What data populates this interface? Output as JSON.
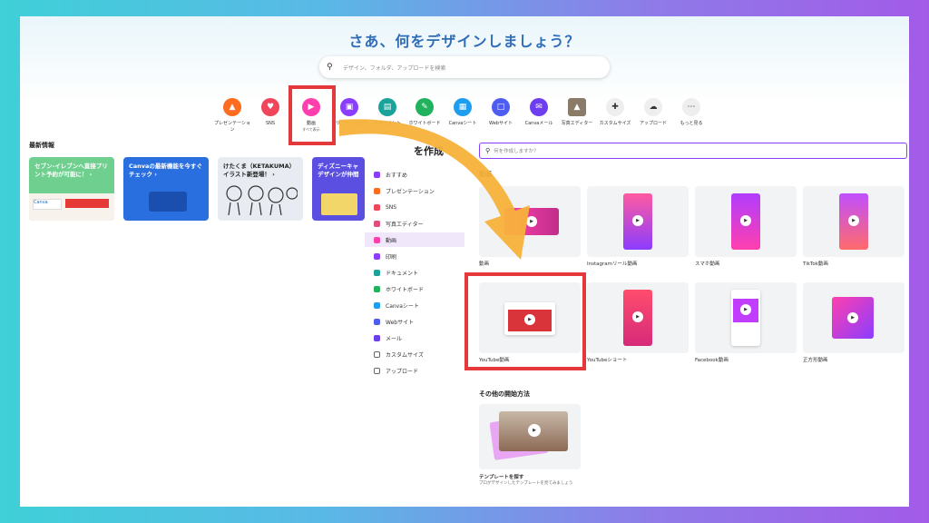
{
  "hero": {
    "title": "さあ、何をデザインしましょう？",
    "search_placeholder": "デザイン、フォルダ、アップロードを検索"
  },
  "categories": [
    {
      "label": "プレゼンテーション",
      "color": "#ff6b1f",
      "icon": "presentation-icon"
    },
    {
      "label": "SNS",
      "color": "#f0455a",
      "icon": "heart-icon"
    },
    {
      "label": "動画",
      "sub": "すべて表示",
      "color": "#ff3fae",
      "icon": "video-icon"
    },
    {
      "label": "プリントショップ",
      "color": "#8b3dff",
      "icon": "print-icon"
    },
    {
      "label": "ドキュメント",
      "color": "#1aa39a",
      "icon": "document-icon"
    },
    {
      "label": "ホワイトボード",
      "color": "#20b25c",
      "icon": "whiteboard-icon"
    },
    {
      "label": "Canvaシート",
      "color": "#1f9ef0",
      "icon": "sheet-icon"
    },
    {
      "label": "Webサイト",
      "color": "#4f5cf0",
      "icon": "website-icon"
    },
    {
      "label": "Canvaメール",
      "color": "#6d3df0",
      "icon": "mail-icon"
    },
    {
      "label": "写真エディター",
      "color": "#8a7b68",
      "icon": "photo-icon"
    },
    {
      "label": "カスタムサイズ",
      "color": "#eeeeee",
      "icon": "custom-size-icon"
    },
    {
      "label": "アップロード",
      "color": "#eeeeee",
      "icon": "upload-icon"
    },
    {
      "label": "もっと見る",
      "color": "#eeeeee",
      "icon": "more-icon"
    }
  ],
  "news": {
    "title": "最新情報",
    "cards": [
      {
        "text": "セブン-イレブンへ直接プリント予約が可能に！ ›",
        "bg": "#6fcf8f",
        "fg": "#ffffff"
      },
      {
        "text": "Canvaの最新機能を今すぐチェック ›",
        "bg": "#2a6fe0",
        "fg": "#ffffff"
      },
      {
        "text": "けたくま（KETAKUMA）イラスト新登場！ ›",
        "bg": "#e8ecf2",
        "fg": "#222222"
      },
      {
        "text": "ディズニーキャ デザインが仲間",
        "bg": "#5a4fe0",
        "fg": "#ffffff"
      }
    ]
  },
  "menu": {
    "title": "を作成",
    "items": [
      {
        "label": "おすすめ",
        "color": "#8b3dff"
      },
      {
        "label": "プレゼンテーション",
        "color": "#ff6b1f"
      },
      {
        "label": "SNS",
        "color": "#f0455a"
      },
      {
        "label": "写真エディター",
        "color": "#e04f7a"
      },
      {
        "label": "動画",
        "color": "#ff3fae",
        "active": true
      },
      {
        "label": "印刷",
        "color": "#8b3dff"
      },
      {
        "label": "ドキュメント",
        "color": "#1aa39a"
      },
      {
        "label": "ホワイトボード",
        "color": "#20b25c"
      },
      {
        "label": "Canvaシート",
        "color": "#1f9ef0"
      },
      {
        "label": "Webサイト",
        "color": "#4f5cf0"
      },
      {
        "label": "メール",
        "color": "#6d3df0"
      },
      {
        "label": "カスタムサイズ",
        "color": "#666666"
      },
      {
        "label": "アップロード",
        "color": "#666666"
      }
    ]
  },
  "panel": {
    "search_placeholder": "何を作成しますか？",
    "section_title": "動画",
    "tiles": [
      {
        "label": "動画"
      },
      {
        "label": "Instagramリール動画"
      },
      {
        "label": "スマホ動画"
      },
      {
        "label": "TikTok動画"
      },
      {
        "label": "YouTube動画"
      },
      {
        "label": "YouTubeショート"
      },
      {
        "label": "Facebook動画"
      },
      {
        "label": "正方形動画"
      }
    ],
    "other_title": "その他の開始方法",
    "template_title": "テンプレートを探す",
    "template_desc": "プロがデザインしたテンプレートを見てみましょう"
  },
  "colors": {
    "highlight": "#e5383b",
    "arrow": "#f7b13a",
    "accent": "#8b3dff"
  }
}
